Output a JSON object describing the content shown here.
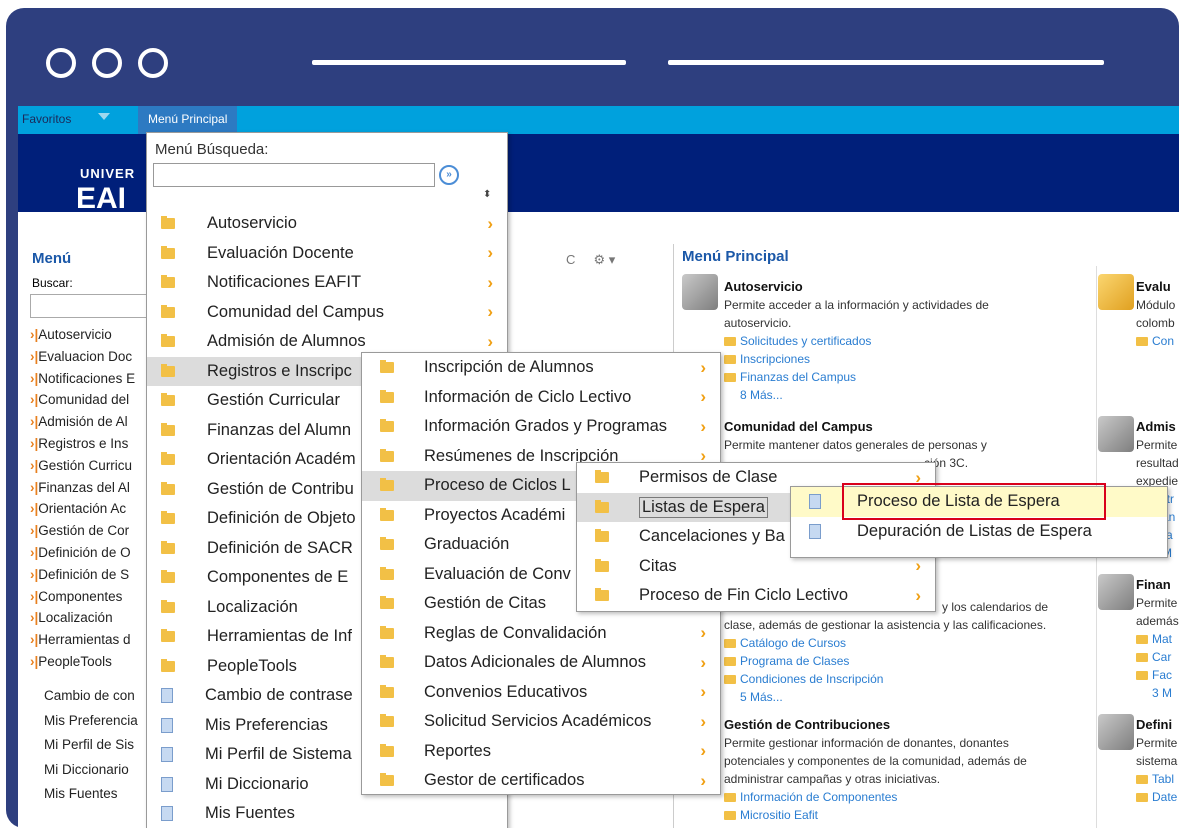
{
  "window": {
    "dots": 3
  },
  "topbar": {
    "favorites": "Favoritos",
    "main_menu": "Menú Principal"
  },
  "logo": {
    "line1": "UNIVER",
    "line2": "EAI"
  },
  "left_panel": {
    "title": "Menú",
    "search_label": "Buscar:",
    "items": [
      "Autoservicio",
      "Evaluacion Doc",
      "Notificaciones E",
      "Comunidad del",
      "Admisión de Al",
      "Registros e Ins",
      "Gestión Curricu",
      "Finanzas del Al",
      "Orientación Ac",
      "Gestión de Cor",
      "Definición de O",
      "Definición de S",
      "Componentes",
      "Localización",
      "Herramientas d",
      "PeopleTools"
    ],
    "plain_items": [
      "Cambio de con",
      "Mis Preferencia",
      "Mi Perfil de Sis",
      "Mi Diccionario",
      "Mis Fuentes"
    ]
  },
  "center_tools": {
    "refresh": "C",
    "gear": "⚙ ▾"
  },
  "right_panel": {
    "title": "Menú Principal",
    "blocks": [
      {
        "title": "Autoservicio",
        "desc1": "Permite acceder a la información y actividades de",
        "desc2": "autoservicio.",
        "links": [
          "Solicitudes y certificados",
          "Inscripciones",
          "Finanzas del Campus"
        ],
        "more": "8 Más..."
      },
      {
        "title": "Comunidad del Campus",
        "desc1": "Permite mantener datos generales de personas y",
        "desc2": "ción 3C."
      },
      {
        "desc1": "y los calendarios de",
        "desc2": "clase, además de gestionar la asistencia y las calificaciones.",
        "links": [
          "Catálogo de Cursos",
          "Programa de Clases",
          "Condiciones de Inscripción"
        ],
        "more": "5 Más..."
      },
      {
        "title": "Gestión de Contribuciones",
        "desc1": "Permite gestionar información de donantes, donantes",
        "desc2": "potenciales y componentes de la comunidad, además de",
        "desc3": "administrar campañas y otras iniciativas.",
        "links": [
          "Información de Componentes",
          "Micrositio Eafit"
        ]
      }
    ],
    "col2": [
      {
        "title": "Evalu",
        "lines": [
          "Módulo",
          "colomb"
        ],
        "links": [
          "Con"
        ]
      },
      {
        "title": "Admis",
        "lines": [
          "Permite",
          "resultad",
          "expedie"
        ],
        "links": [
          "Entr",
          "Man",
          "Eva"
        ],
        "more": "4 M"
      },
      {
        "title": "Finan",
        "lines": [
          "Permite",
          "además"
        ],
        "links": [
          "Mat",
          "Car",
          "Fac"
        ],
        "more": "3 M"
      },
      {
        "title": "Defini",
        "lines": [
          "Permite",
          "sistema"
        ],
        "links": [
          "Tabl",
          "Date"
        ]
      }
    ]
  },
  "menu1": {
    "search_label": "Menú Búsqueda:",
    "go": "»",
    "sort": "⬍",
    "items": [
      {
        "label": "Autoservicio",
        "type": "folder"
      },
      {
        "label": "Evaluación Docente",
        "type": "folder"
      },
      {
        "label": "Notificaciones EAFIT",
        "type": "folder"
      },
      {
        "label": "Comunidad del Campus",
        "type": "folder"
      },
      {
        "label": "Admisión de Alumnos",
        "type": "folder"
      },
      {
        "label": "Registros e Inscripc",
        "type": "folder"
      },
      {
        "label": "Gestión Curricular",
        "type": "folder"
      },
      {
        "label": "Finanzas del Alumn",
        "type": "folder"
      },
      {
        "label": "Orientación Académ",
        "type": "folder"
      },
      {
        "label": "Gestión de Contribu",
        "type": "folder"
      },
      {
        "label": "Definición de Objeto",
        "type": "folder"
      },
      {
        "label": "Definición de SACR",
        "type": "folder"
      },
      {
        "label": "Componentes de E",
        "type": "folder"
      },
      {
        "label": "Localización",
        "type": "folder"
      },
      {
        "label": "Herramientas de Inf",
        "type": "folder"
      },
      {
        "label": "PeopleTools",
        "type": "folder"
      },
      {
        "label": "Cambio de contrase",
        "type": "doc"
      },
      {
        "label": "Mis Preferencias",
        "type": "doc"
      },
      {
        "label": "Mi Perfil de Sistema",
        "type": "doc"
      },
      {
        "label": "Mi Diccionario",
        "type": "doc"
      },
      {
        "label": "Mis Fuentes",
        "type": "doc"
      }
    ]
  },
  "menu2": {
    "items": [
      "Inscripción de Alumnos",
      "Información de Ciclo Lectivo",
      "Información Grados y Programas",
      "Resúmenes de Inscripción",
      "Proceso de Ciclos L",
      "Proyectos Académi",
      "Graduación",
      "Evaluación de Conv",
      "Gestión de Citas",
      "Reglas de Convalidación",
      "Datos Adicionales de Alumnos",
      "Convenios Educativos",
      "Solicitud Servicios Académicos",
      "Reportes",
      "Gestor de certificados"
    ]
  },
  "menu3": {
    "items": [
      "Permisos de Clase",
      "Listas de Espera",
      "Cancelaciones y Ba",
      "Citas",
      "Proceso de Fin Ciclo Lectivo"
    ]
  },
  "menu4": {
    "items": [
      "Proceso de Lista de Espera",
      "Depuración de Listas de Espera"
    ]
  },
  "arrow_glyph": "›"
}
